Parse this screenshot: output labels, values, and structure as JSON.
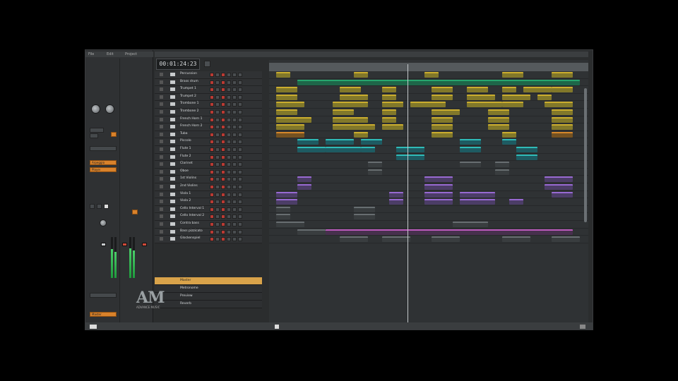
{
  "timer": "00:01:24:23",
  "logo": {
    "text": "AM",
    "tagline": "ADVANCE MUSIC"
  },
  "inspector": {
    "menu": [
      "File",
      "Edit",
      "Project"
    ],
    "button_labels": [
      "Arpeggio",
      "Player",
      "Master"
    ]
  },
  "tracks": [
    {
      "name": "Percussion"
    },
    {
      "name": "Brass drum"
    },
    {
      "name": "Trumpet 1"
    },
    {
      "name": "Trumpet 2"
    },
    {
      "name": "Trombone 1"
    },
    {
      "name": "Trombone 2"
    },
    {
      "name": "French Horn 1"
    },
    {
      "name": "French Horn 2"
    },
    {
      "name": "Tuba"
    },
    {
      "name": "Piccolo"
    },
    {
      "name": "Flute 1"
    },
    {
      "name": "Flute 2"
    },
    {
      "name": "Clarinet"
    },
    {
      "name": "Oboe"
    },
    {
      "name": "1st Violins"
    },
    {
      "name": "2nd Violins"
    },
    {
      "name": "Viola 1"
    },
    {
      "name": "Viola 2"
    },
    {
      "name": "Cello Interval 1"
    },
    {
      "name": "Cello Interval 2"
    },
    {
      "name": "Contra bass"
    },
    {
      "name": "Bass pizzicato"
    },
    {
      "name": "Glockenspiel"
    }
  ],
  "lower_tracks": [
    {
      "name": "Master"
    },
    {
      "name": "Metronome"
    },
    {
      "name": "Preview"
    },
    {
      "name": "Reverb"
    }
  ],
  "colors": {
    "yellow": "#d9b82e",
    "green": "#27b073",
    "cyan": "#2fc7c4",
    "purple": "#a16ee0",
    "magenta": "#c85ec8",
    "orange": "#e38f2a"
  }
}
